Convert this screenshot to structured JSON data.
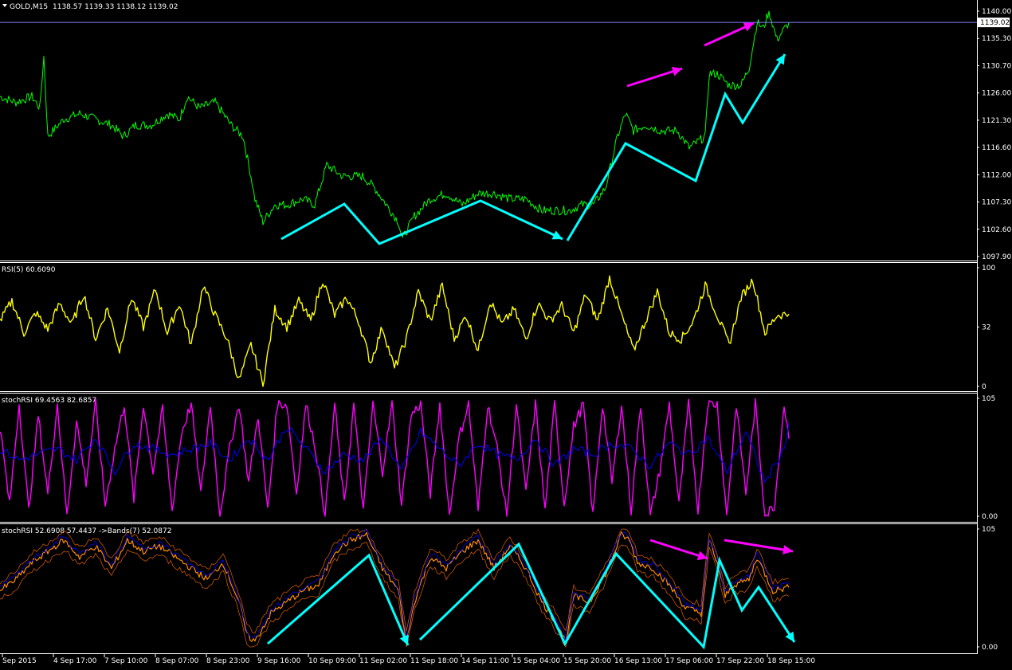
{
  "header": {
    "symbol": "GOLD,M15",
    "ohlc": "1138.57 1139.33 1138.12 1139.02"
  },
  "colors": {
    "background": "#000000",
    "price": "#00ff00",
    "rsi": "#ffff00",
    "stoch_main": "#ff00ff",
    "stoch_signal": "#0000ff",
    "stoch_bands": "#ff8c00",
    "arrow_cyan": "#00ffff",
    "arrow_magenta": "#ff00ff",
    "grid_border": "#ffffff",
    "bid_line": "#8080ff"
  },
  "time_axis": [
    "Sep 2015",
    "4 Sep 17:00",
    "7 Sep 10:00",
    "8 Sep 07:00",
    "8 Sep 23:00",
    "9 Sep 16:00",
    "10 Sep 09:00",
    "11 Sep 02:00",
    "11 Sep 18:00",
    "14 Sep 11:00",
    "15 Sep 04:00",
    "15 Sep 20:00",
    "16 Sep 13:00",
    "17 Sep 06:00",
    "17 Sep 22:00",
    "18 Sep 15:00"
  ],
  "chart_data": [
    {
      "type": "line",
      "panel": "price",
      "title": "GOLD,M15",
      "ylim": [
        1097.9,
        1141.0
      ],
      "y_ticks": [
        "1140.00",
        "1135.30",
        "1130.70",
        "1126.00",
        "1121.30",
        "1116.60",
        "1112.00",
        "1107.30",
        "1102.60",
        "1097.90"
      ],
      "current_price": "1139.02",
      "series": [
        {
          "x": [
            0,
            20,
            40,
            50,
            55,
            60,
            80,
            100,
            120,
            140,
            155,
            170,
            190,
            210,
            225,
            235,
            250,
            270,
            290,
            305,
            315,
            320,
            330,
            345,
            360,
            380,
            395,
            410,
            430,
            455,
            470,
            485,
            500,
            505,
            520,
            540,
            560,
            580,
            600,
            620,
            640,
            660,
            680,
            700,
            715,
            730,
            745,
            760,
            775,
            785,
            795,
            810,
            830,
            850,
            865,
            875,
            885,
            890,
            900,
            915,
            930,
            940,
            950,
            958,
            965,
            975,
            985,
            990
          ],
          "y": [
            1126,
            1125,
            1126,
            1124,
            1133,
            1119,
            1122,
            1123,
            1122,
            1121,
            1119,
            1121,
            1121,
            1123,
            1122,
            1126,
            1124,
            1125,
            1121,
            1119,
            1112,
            1108,
            1104,
            1107,
            1107,
            1108,
            1107,
            1114,
            1112,
            1112,
            1110,
            1107,
            1104,
            1101,
            1105,
            1108,
            1109,
            1107,
            1109,
            1109,
            1108,
            1108,
            1106,
            1106,
            1106,
            1107,
            1107,
            1110,
            1119,
            1123,
            1120,
            1121,
            1120,
            1120,
            1117,
            1118,
            1119,
            1130,
            1130,
            1128,
            1128,
            1131,
            1139,
            1138,
            1141,
            1136,
            1138,
            1139
          ]
        }
      ]
    },
    {
      "type": "line",
      "panel": "rsi",
      "title": "RSI(5) 60.6090",
      "ylim": [
        0,
        100
      ],
      "y_ticks": [
        "100",
        "32",
        "0"
      ],
      "series": [
        {
          "x": [
            0,
            15,
            30,
            45,
            60,
            75,
            90,
            105,
            120,
            135,
            150,
            165,
            180,
            195,
            210,
            225,
            240,
            255,
            270,
            285,
            300,
            315,
            330,
            345,
            360,
            375,
            390,
            405,
            420,
            435,
            450,
            465,
            480,
            495,
            510,
            525,
            540,
            555,
            570,
            585,
            600,
            615,
            630,
            645,
            660,
            675,
            690,
            705,
            720,
            735,
            750,
            765,
            780,
            795,
            810,
            825,
            840,
            855,
            870,
            885,
            900,
            915,
            930,
            945,
            960,
            975,
            990
          ],
          "y": [
            55,
            72,
            45,
            62,
            48,
            70,
            52,
            78,
            40,
            66,
            30,
            75,
            50,
            82,
            45,
            70,
            35,
            85,
            60,
            40,
            5,
            35,
            2,
            65,
            50,
            72,
            55,
            90,
            60,
            75,
            55,
            20,
            50,
            15,
            40,
            80,
            55,
            85,
            40,
            60,
            30,
            72,
            52,
            65,
            40,
            70,
            55,
            68,
            45,
            78,
            55,
            92,
            60,
            30,
            55,
            80,
            45,
            40,
            55,
            85,
            60,
            35,
            75,
            90,
            45,
            60,
            61
          ]
        }
      ]
    },
    {
      "type": "line",
      "panel": "stochrsi_1",
      "title": "stochRSI 69.4563 82.6857",
      "ylim": [
        0,
        105
      ],
      "y_ticks": [
        "105",
        "0.00"
      ],
      "series": [
        {
          "name": "stochRSI main",
          "x": [
            0,
            12,
            24,
            36,
            48,
            60,
            72,
            84,
            96,
            108,
            120,
            132,
            144,
            156,
            168,
            180,
            192,
            204,
            216,
            228,
            240,
            252,
            264,
            276,
            288,
            300,
            312,
            324,
            336,
            348,
            360,
            372,
            384,
            396,
            408,
            420,
            432,
            444,
            456,
            468,
            480,
            492,
            504,
            516,
            528,
            540,
            552,
            564,
            576,
            588,
            600,
            612,
            624,
            636,
            648,
            660,
            672,
            684,
            696,
            708,
            720,
            732,
            744,
            756,
            768,
            780,
            792,
            804,
            816,
            828,
            840,
            852,
            864,
            876,
            888,
            900,
            912,
            924,
            936,
            948,
            960,
            972,
            984,
            990
          ],
          "y": [
            80,
            10,
            100,
            5,
            90,
            20,
            100,
            0,
            85,
            30,
            100,
            10,
            60,
            100,
            15,
            100,
            40,
            95,
            5,
            75,
            100,
            20,
            100,
            0,
            60,
            100,
            30,
            90,
            5,
            100,
            100,
            20,
            100,
            60,
            0,
            100,
            10,
            100,
            5,
            100,
            40,
            100,
            10,
            90,
            100,
            20,
            100,
            0,
            70,
            100,
            5,
            100,
            60,
            0,
            100,
            20,
            100,
            5,
            100,
            10,
            80,
            100,
            0,
            100,
            30,
            100,
            5,
            100,
            0,
            40,
            100,
            10,
            100,
            5,
            100,
            100,
            0,
            100,
            20,
            100,
            0,
            10,
            100,
            69
          ]
        },
        {
          "name": "stochRSI signal",
          "x": [
            0,
            24,
            48,
            72,
            96,
            120,
            144,
            168,
            192,
            216,
            240,
            264,
            288,
            312,
            336,
            360,
            384,
            408,
            432,
            456,
            480,
            504,
            528,
            552,
            576,
            600,
            624,
            648,
            672,
            696,
            720,
            744,
            768,
            792,
            816,
            840,
            864,
            888,
            912,
            936,
            960,
            984,
            990
          ],
          "y": [
            60,
            50,
            55,
            60,
            50,
            70,
            40,
            65,
            60,
            55,
            60,
            65,
            50,
            70,
            50,
            80,
            60,
            40,
            55,
            50,
            70,
            40,
            75,
            60,
            45,
            65,
            55,
            50,
            70,
            45,
            60,
            55,
            65,
            60,
            45,
            65,
            55,
            70,
            40,
            75,
            30,
            60,
            83
          ]
        }
      ]
    },
    {
      "type": "line",
      "panel": "stochrsi_bands",
      "title": "stochRSI 52.6908 57.4437 ->Bands(7) 52.0872",
      "ylim": [
        0,
        105
      ],
      "y_ticks": [
        "105",
        "0.00"
      ],
      "series": [
        {
          "name": "stochRSI",
          "x": [
            0,
            20,
            40,
            60,
            80,
            100,
            120,
            140,
            160,
            180,
            200,
            220,
            240,
            260,
            280,
            300,
            310,
            320,
            340,
            360,
            380,
            400,
            420,
            440,
            460,
            480,
            500,
            510,
            520,
            540,
            560,
            580,
            600,
            620,
            640,
            660,
            680,
            700,
            710,
            720,
            740,
            760,
            780,
            790,
            800,
            820,
            840,
            860,
            880,
            890,
            900,
            910,
            920,
            940,
            950,
            960,
            970,
            990
          ],
          "y": [
            50,
            60,
            75,
            85,
            95,
            80,
            90,
            70,
            95,
            85,
            90,
            80,
            70,
            60,
            75,
            40,
            10,
            5,
            30,
            40,
            50,
            55,
            85,
            95,
            100,
            70,
            50,
            5,
            40,
            80,
            70,
            85,
            95,
            70,
            90,
            70,
            40,
            20,
            5,
            45,
            40,
            65,
            100,
            95,
            75,
            70,
            55,
            35,
            30,
            95,
            75,
            45,
            55,
            60,
            80,
            65,
            50,
            53
          ]
        }
      ]
    }
  ]
}
